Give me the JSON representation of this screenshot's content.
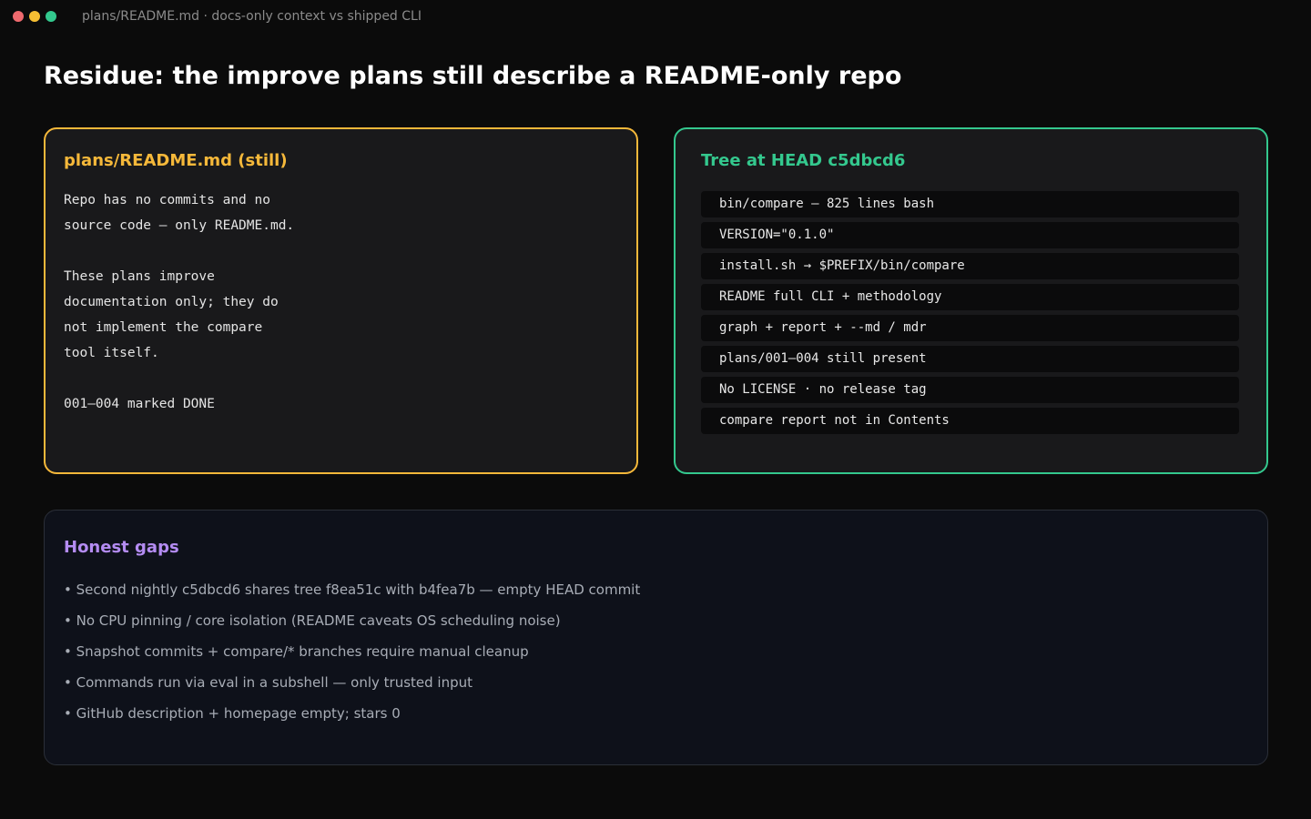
{
  "window": {
    "title": "plans/README.md · docs-only context vs shipped CLI",
    "controls": {
      "close_color": "#ef6a6e",
      "minimize_color": "#f5be33",
      "maximize_color": "#33c98e"
    }
  },
  "page": {
    "title": "Residue: the improve plans still describe a README-only repo"
  },
  "plans_panel": {
    "heading": "plans/README.md (still)",
    "accent": "#f5b83a",
    "lines": [
      "Repo has no commits and no",
      "source code — only README.md.",
      "",
      "These plans improve",
      "documentation only; they do",
      "not implement the compare",
      "tool itself.",
      "",
      "001–004 marked DONE"
    ]
  },
  "tree_panel": {
    "heading": "Tree at HEAD c5dbcd6",
    "accent": "#34c88e",
    "items": [
      "bin/compare — 825 lines bash",
      "VERSION=\"0.1.0\"",
      "install.sh → $PREFIX/bin/compare",
      "README full CLI + methodology",
      "graph + report + --md / mdr",
      "plans/001–004 still present",
      "No LICENSE · no release tag",
      "compare report not in Contents"
    ]
  },
  "gaps_panel": {
    "heading": "Honest gaps",
    "accent": "#b48cf2",
    "items": [
      "• Second nightly c5dbcd6 shares tree f8ea51c with b4fea7b — empty HEAD commit",
      "• No CPU pinning / core isolation (README caveats OS scheduling noise)",
      "• Snapshot commits + compare/* branches require manual cleanup",
      "• Commands run via eval in a subshell — only trusted input",
      "• GitHub description + homepage empty; stars 0"
    ]
  }
}
